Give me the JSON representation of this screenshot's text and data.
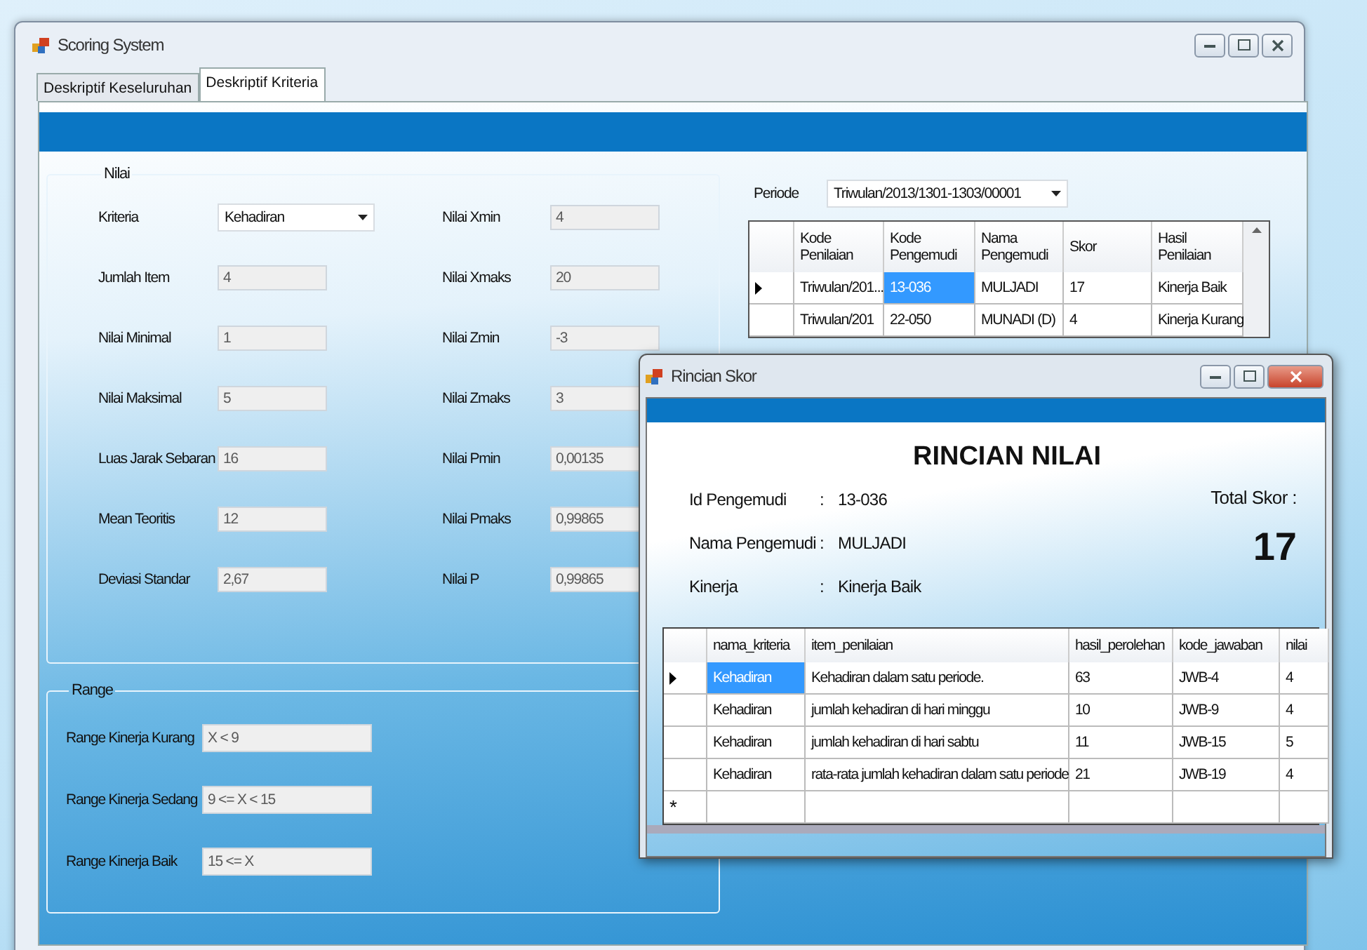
{
  "window": {
    "title": "Scoring System"
  },
  "tabs": [
    {
      "label": "Deskriptif Keseluruhan",
      "selected": false
    },
    {
      "label": "Deskriptif Kriteria",
      "selected": true
    }
  ],
  "nilai": {
    "title": "Nilai",
    "left": [
      {
        "kind": "dropdown",
        "label": "Kriteria",
        "value": "Kehadiran"
      },
      {
        "kind": "field",
        "label": "Jumlah Item",
        "value": "4"
      },
      {
        "kind": "field",
        "label": "Nilai Minimal",
        "value": "1"
      },
      {
        "kind": "field",
        "label": "Nilai Maksimal",
        "value": "5"
      },
      {
        "kind": "field",
        "label": "Luas Jarak Sebaran",
        "value": "16"
      },
      {
        "kind": "field",
        "label": "Mean Teoritis",
        "value": "12"
      },
      {
        "kind": "field",
        "label": "Deviasi Standar",
        "value": "2,67"
      }
    ],
    "right": [
      {
        "kind": "field",
        "label": "Nilai Xmin",
        "value": "4"
      },
      {
        "kind": "field",
        "label": "Nilai Xmaks",
        "value": "20"
      },
      {
        "kind": "field",
        "label": "Nilai Zmin",
        "value": "-3"
      },
      {
        "kind": "field",
        "label": "Nilai Zmaks",
        "value": "3"
      },
      {
        "kind": "field",
        "label": "Nilai Pmin",
        "value": "0,00135"
      },
      {
        "kind": "field",
        "label": "Nilai Pmaks",
        "value": "0,99865"
      },
      {
        "kind": "field",
        "label": "Nilai P",
        "value": "0,99865"
      }
    ]
  },
  "range": {
    "title": "Range",
    "fields": [
      {
        "label": "Range Kinerja Kurang",
        "value": "X < 9"
      },
      {
        "label": "Range Kinerja Sedang",
        "value": "9 <= X < 15"
      },
      {
        "label": "Range Kinerja Baik",
        "value": "15 <= X"
      }
    ]
  },
  "periode": {
    "label": "Periode",
    "value": "Triwulan/2013/1301-1303/00001"
  },
  "grid": {
    "columns": [
      "Kode\nPenilaian",
      "Kode\nPengemudi",
      "Nama\nPengemudi",
      "Skor",
      "Hasil\nPenilaian"
    ],
    "rows": [
      {
        "current": true,
        "cells": [
          {
            "text": "Triwulan/201...",
            "selected": false
          },
          {
            "text": "13-036",
            "selected": true
          },
          {
            "text": "MULJADI",
            "selected": false
          },
          {
            "text": "17",
            "selected": false
          },
          {
            "text": "Kinerja Baik",
            "selected": false
          }
        ]
      },
      {
        "current": false,
        "cells": [
          {
            "text": "Triwulan/201",
            "selected": false
          },
          {
            "text": "22-050",
            "selected": false
          },
          {
            "text": "MUNADI (D)",
            "selected": false
          },
          {
            "text": "4",
            "selected": false
          },
          {
            "text": "Kinerja Kurang",
            "selected": false
          }
        ]
      }
    ]
  },
  "dialog": {
    "title": "Rincian Skor",
    "heading": "RINCIAN NILAI",
    "info": [
      {
        "label": "Id Pengemudi",
        "separator": ":",
        "value": "13-036"
      },
      {
        "label": "Nama Pengemudi",
        "separator": ":",
        "value": "MULJADI"
      },
      {
        "label": "Kinerja",
        "separator": ":",
        "value": "Kinerja Baik"
      }
    ],
    "total_label": "Total Skor :",
    "total": "17",
    "grid": {
      "columns": [
        "nama_kriteria",
        "item_penilaian",
        "hasil_perolehan",
        "kode_jawaban",
        "nilai"
      ],
      "rows": [
        {
          "current": true,
          "cells": [
            {
              "text": "Kehadiran",
              "selected": true
            },
            {
              "text": "Kehadiran dalam satu periode.",
              "selected": false
            },
            {
              "text": "63",
              "selected": false
            },
            {
              "text": "JWB-4",
              "selected": false
            },
            {
              "text": "4",
              "selected": false
            }
          ]
        },
        {
          "current": false,
          "cells": [
            {
              "text": "Kehadiran",
              "selected": false
            },
            {
              "text": "jumlah kehadiran di hari minggu",
              "selected": false
            },
            {
              "text": "10",
              "selected": false
            },
            {
              "text": "JWB-9",
              "selected": false
            },
            {
              "text": "4",
              "selected": false
            }
          ]
        },
        {
          "current": false,
          "cells": [
            {
              "text": "Kehadiran",
              "selected": false
            },
            {
              "text": "jumlah kehadiran di hari sabtu",
              "selected": false
            },
            {
              "text": "11",
              "selected": false
            },
            {
              "text": "JWB-15",
              "selected": false
            },
            {
              "text": "5",
              "selected": false
            }
          ]
        },
        {
          "current": false,
          "cells": [
            {
              "text": "Kehadiran",
              "selected": false
            },
            {
              "text": "rata-rata jumlah kehadiran dalam satu periode",
              "selected": false
            },
            {
              "text": "21",
              "selected": false
            },
            {
              "text": "JWB-19",
              "selected": false
            },
            {
              "text": "4",
              "selected": false
            }
          ]
        }
      ],
      "new_row_marker": "*"
    }
  }
}
